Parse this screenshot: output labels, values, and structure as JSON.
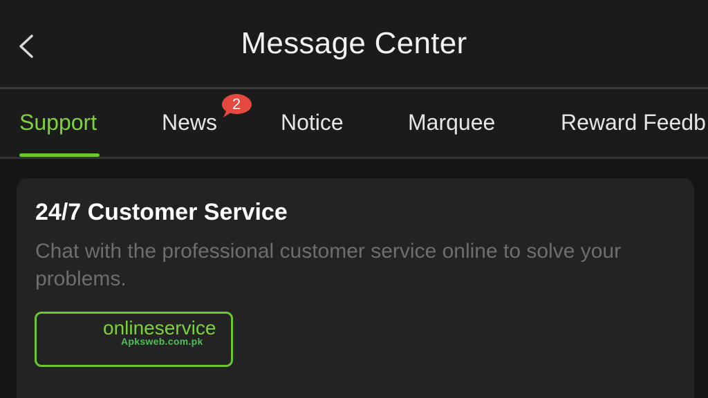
{
  "header": {
    "title": "Message Center",
    "back_icon": "chevron-left-icon"
  },
  "tabs": [
    {
      "label": "Support",
      "active": true
    },
    {
      "label": "News",
      "badge": "2"
    },
    {
      "label": "Notice"
    },
    {
      "label": "Marquee"
    },
    {
      "label": "Reward Feedb"
    }
  ],
  "card": {
    "title": "24/7 Customer Service",
    "description": "Chat with the professional customer service online to solve your problems.",
    "button_label": "onlineservice"
  },
  "watermark": "Apksweb.com.pk",
  "colors": {
    "accent": "#7fd13b",
    "badge": "#e5483e",
    "background": "#181818",
    "card": "#232323"
  }
}
